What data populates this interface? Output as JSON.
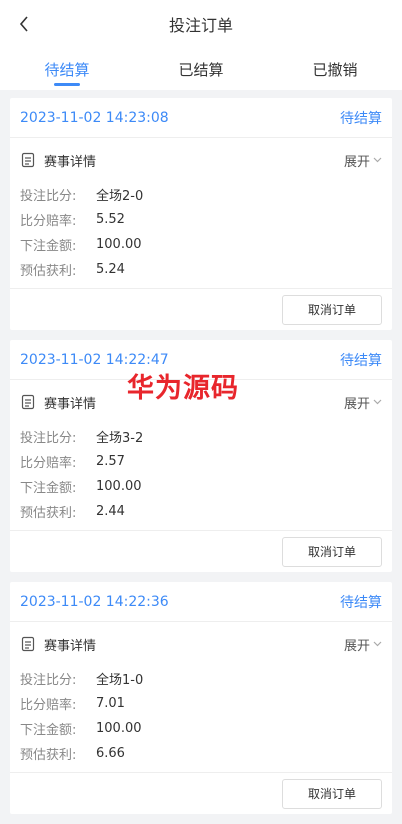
{
  "nav": {
    "title": "投注订单"
  },
  "tabs": [
    {
      "label": "待结算",
      "active": true
    },
    {
      "label": "已结算",
      "active": false
    },
    {
      "label": "已撤销",
      "active": false
    }
  ],
  "orders": [
    {
      "time": "2023-11-02 14:23:08",
      "status": "待结算",
      "detail_label": "赛事详情",
      "expand_label": "展开",
      "fields": [
        {
          "key": "投注比分:",
          "value": "全场2-0"
        },
        {
          "key": "比分赔率:",
          "value": "5.52"
        },
        {
          "key": "下注金额:",
          "value": "100.00"
        },
        {
          "key": "预估获利:",
          "value": "5.24"
        }
      ],
      "cancel_label": "取消订单"
    },
    {
      "time": "2023-11-02 14:22:47",
      "status": "待结算",
      "detail_label": "赛事详情",
      "expand_label": "展开",
      "fields": [
        {
          "key": "投注比分:",
          "value": "全场3-2"
        },
        {
          "key": "比分赔率:",
          "value": "2.57"
        },
        {
          "key": "下注金额:",
          "value": "100.00"
        },
        {
          "key": "预估获利:",
          "value": "2.44"
        }
      ],
      "cancel_label": "取消订单"
    },
    {
      "time": "2023-11-02 14:22:36",
      "status": "待结算",
      "detail_label": "赛事详情",
      "expand_label": "展开",
      "fields": [
        {
          "key": "投注比分:",
          "value": "全场1-0"
        },
        {
          "key": "比分赔率:",
          "value": "7.01"
        },
        {
          "key": "下注金额:",
          "value": "100.00"
        },
        {
          "key": "预估获利:",
          "value": "6.66"
        }
      ],
      "cancel_label": "取消订单"
    }
  ],
  "watermark": "华为源码",
  "colors": {
    "accent": "#3d8af7",
    "watermark": "#e8262c",
    "background": "#f2f3f5"
  },
  "icons": {
    "back": "chevron-left-icon",
    "detail": "document-icon",
    "expand": "chevron-down-icon"
  }
}
